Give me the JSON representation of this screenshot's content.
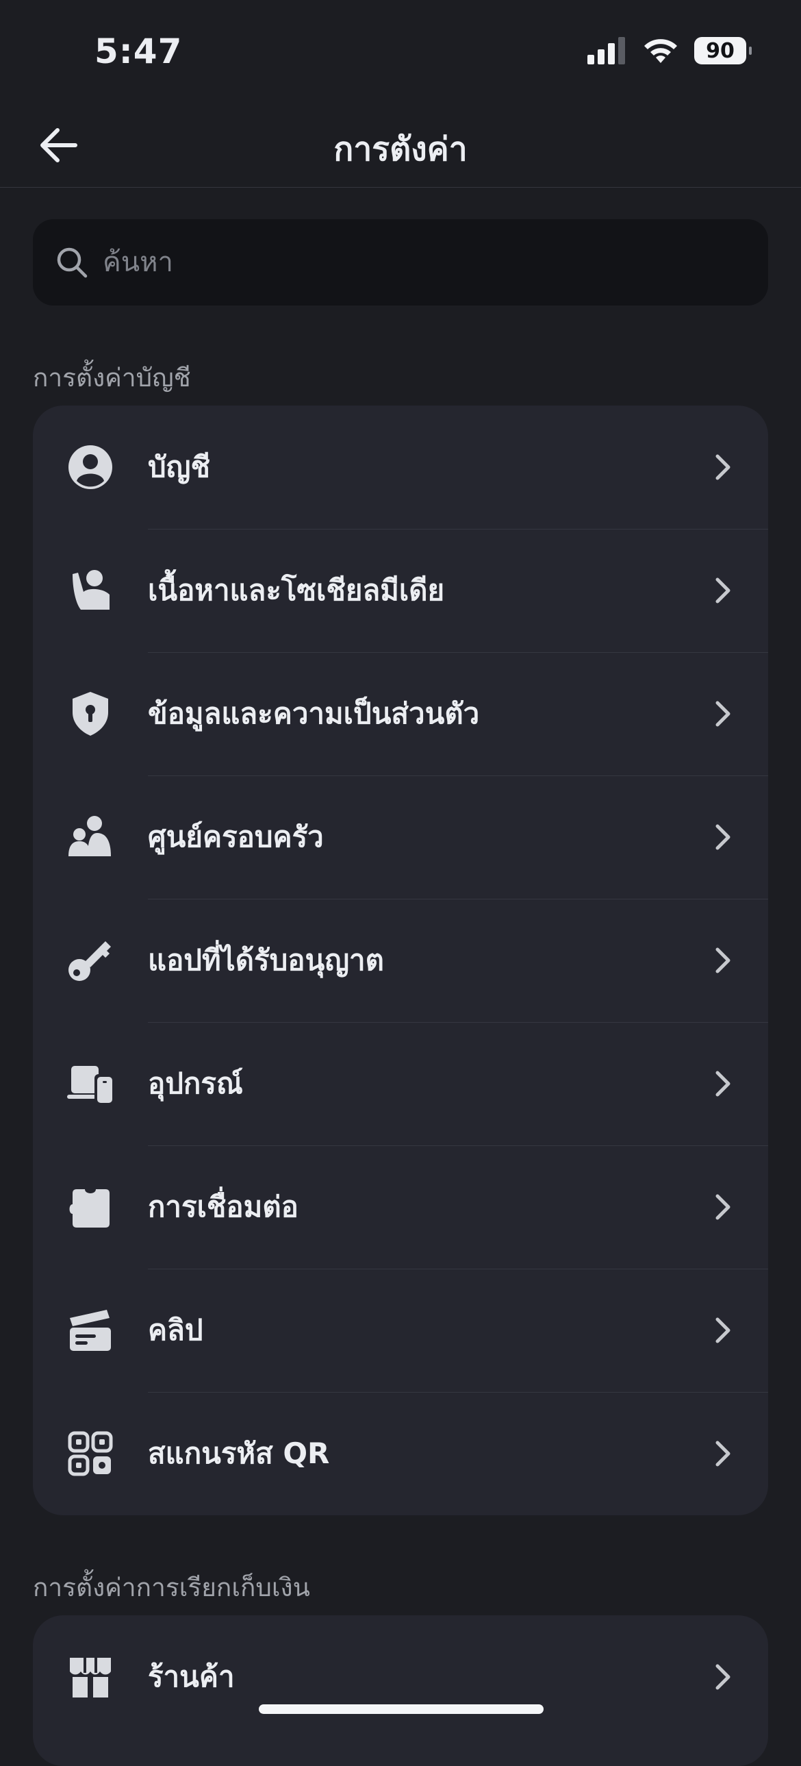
{
  "status": {
    "time": "5:47",
    "battery": "90"
  },
  "nav": {
    "title": "การตังค่า"
  },
  "search": {
    "placeholder": "ค้นหา"
  },
  "sections": {
    "account_settings": "การตั้งค่าบัญชี",
    "billing_settings": "การตั้งค่าการเรียกเก็บเงิน"
  },
  "account_items": [
    {
      "label": "บัญชี",
      "icon": "account-icon"
    },
    {
      "label": "เนื้อหาและโซเชียลมีเดีย",
      "icon": "content-social-icon"
    },
    {
      "label": "ข้อมูลและความเป็นส่วนตัว",
      "icon": "privacy-shield-icon"
    },
    {
      "label": "ศูนย์ครอบครัว",
      "icon": "family-icon"
    },
    {
      "label": "แอปที่ได้รับอนุญาต",
      "icon": "key-icon"
    },
    {
      "label": "อุปกรณ์",
      "icon": "devices-icon"
    },
    {
      "label": "การเชื่อมต่อ",
      "icon": "puzzle-icon"
    },
    {
      "label": "คลิป",
      "icon": "clapperboard-icon"
    },
    {
      "label": "สแกนรหัส QR",
      "icon": "qr-scan-icon"
    }
  ],
  "billing_items": [
    {
      "label": "ร้านค้า",
      "icon": "store-icon"
    }
  ]
}
